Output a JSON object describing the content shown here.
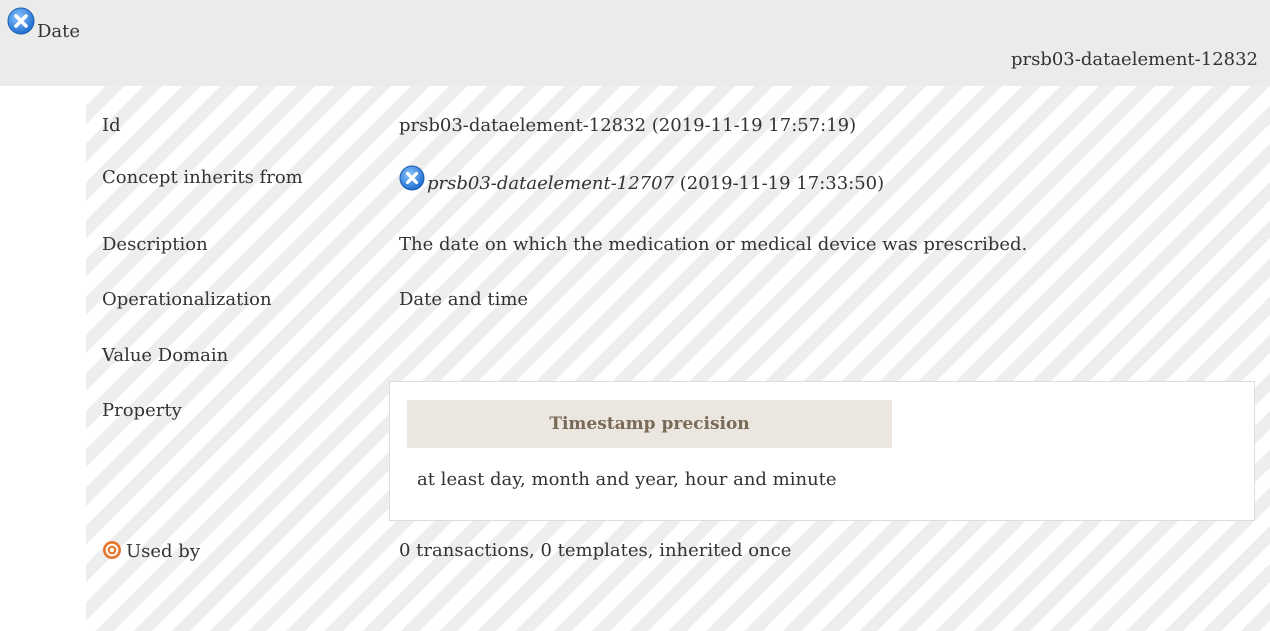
{
  "header": {
    "title": "Date",
    "id": "prsb03-dataelement-12832",
    "icon": "concept-item-icon"
  },
  "rows": {
    "id": {
      "label": "Id",
      "value": "prsb03-dataelement-12832 (2019-11-19 17:57:19)"
    },
    "inherits": {
      "label": "Concept inherits from",
      "link": "prsb03-dataelement-12707",
      "date": " (2019-11-19 17:33:50)",
      "icon": "concept-item-icon"
    },
    "description": {
      "label": "Description",
      "value": "The date on which the medication or medical device was prescribed."
    },
    "operationalization": {
      "label": "Operationalization",
      "value": "Date and time"
    },
    "value_domain": {
      "label": "Value Domain",
      "value": ""
    },
    "property": {
      "label": "Property",
      "heading": "Timestamp precision",
      "value": "at least day, month and year, hour and minute"
    },
    "used_by": {
      "label": "Used by",
      "value": "0 transactions, 0 templates, inherited once",
      "icon": "target-icon"
    }
  },
  "colors": {
    "header_bg": "#ebebeb",
    "icon_blue": "#3a8ee6",
    "property_head_bg": "#ebe6e0",
    "property_head_text": "#7a6a58",
    "target_orange": "#e8772e"
  }
}
